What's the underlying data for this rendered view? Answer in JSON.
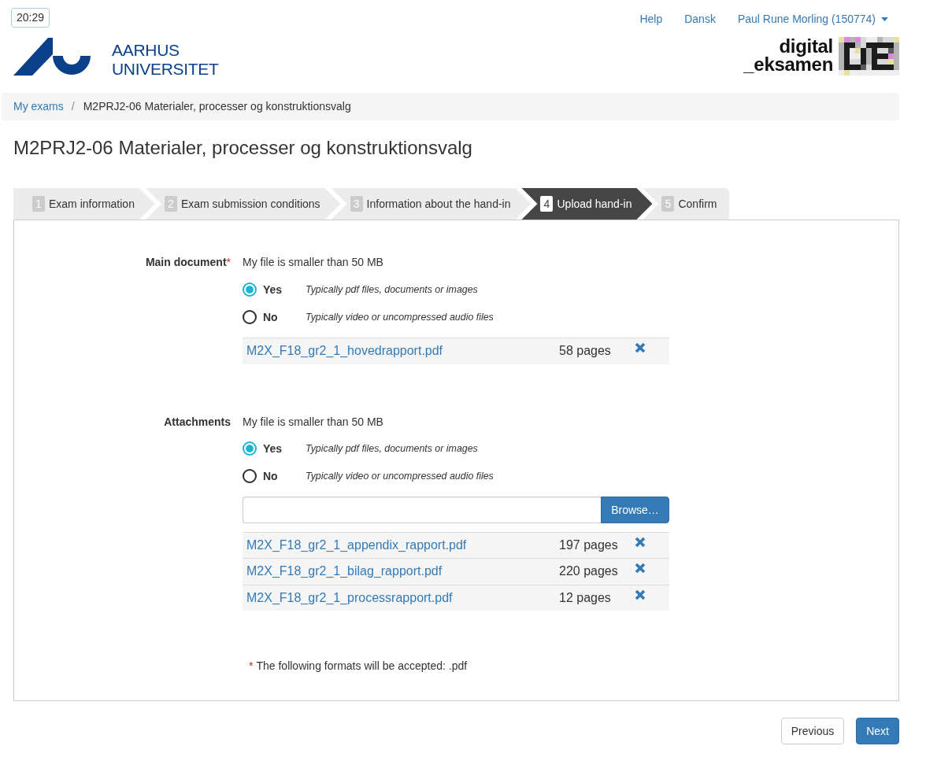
{
  "clock": "20:29",
  "nav": {
    "links": [
      "Help",
      "Dansk"
    ],
    "user": "Paul Rune Morling (150774)"
  },
  "logos": {
    "university": [
      "AARHUS",
      "UNIVERSITET"
    ],
    "exam_system": [
      "digital",
      "_eksamen"
    ]
  },
  "breadcrumb": {
    "separator": "/",
    "items": [
      {
        "label": "My exams",
        "current": false
      },
      {
        "label": "M2PRJ2-06 Materialer, processer og konstruktionsvalg",
        "current": true
      }
    ]
  },
  "page_title": "M2PRJ2-06 Materialer, processer og konstruktionsvalg",
  "steps": [
    {
      "number": "1",
      "label": "Exam information",
      "selected": false
    },
    {
      "number": "2",
      "label": "Exam submission conditions",
      "selected": false
    },
    {
      "number": "3",
      "label": "Information about the hand-in",
      "selected": false
    },
    {
      "number": "4",
      "label": "Upload hand-in",
      "selected": true
    },
    {
      "number": "5",
      "label": "Confirm",
      "selected": false
    }
  ],
  "sections": [
    {
      "label": "Main document",
      "required_mark": "*",
      "size_question": "My file is smaller than 50 MB",
      "options": [
        {
          "label": "Yes",
          "hint": "Typically pdf files, documents or images",
          "selected": true
        },
        {
          "label": "No",
          "hint": "Typically video or uncompressed audio files",
          "selected": false
        }
      ],
      "files": [
        {
          "name": "M2X_F18_gr2_1_hovedrapport.pdf",
          "pages": "58 pages"
        }
      ]
    },
    {
      "label": "Attachments",
      "size_question": "My file is smaller than 50 MB",
      "options": [
        {
          "label": "Yes",
          "hint": "Typically pdf files, documents or images",
          "selected": true
        },
        {
          "label": "No",
          "hint": "Typically video or uncompressed audio files",
          "selected": false
        }
      ],
      "browse_button": "Browse…",
      "files": [
        {
          "name": "M2X_F18_gr2_1_appendix_rapport.pdf",
          "pages": "197 pages"
        },
        {
          "name": "M2X_F18_gr2_1_bilag_rapport.pdf",
          "pages": "220 pages"
        },
        {
          "name": "M2X_F18_gr2_1_processrapport.pdf",
          "pages": "12 pages"
        }
      ]
    }
  ],
  "footnote": {
    "mark": "*",
    "text": "The following formats will be accepted: .pdf"
  },
  "buttons": [
    {
      "label": "Previous",
      "kind": "default"
    },
    {
      "label": "Next",
      "kind": "primary"
    }
  ]
}
